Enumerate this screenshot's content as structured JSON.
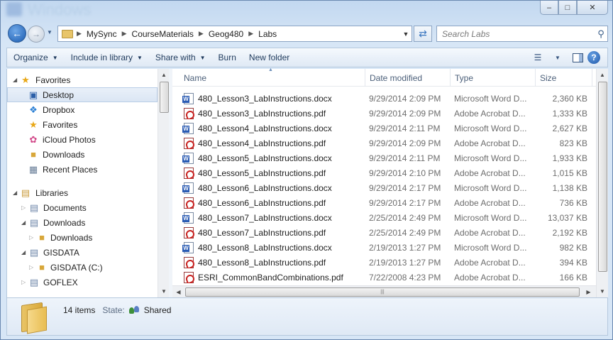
{
  "window": {
    "title": "Windows",
    "minimize_glyph": "–",
    "maximize_glyph": "□",
    "close_glyph": "✕"
  },
  "address": {
    "breadcrumb": [
      "MySync",
      "CourseMaterials",
      "Geog480",
      "Labs"
    ],
    "search_placeholder": "Search Labs"
  },
  "toolbar": {
    "organize": "Organize",
    "include_in_library": "Include in library",
    "share_with": "Share with",
    "burn": "Burn",
    "new_folder": "New folder"
  },
  "nav": {
    "favorites_header": "Favorites",
    "favorites": [
      "Desktop",
      "Dropbox",
      "Favorites",
      "iCloud Photos",
      "Downloads",
      "Recent Places"
    ],
    "libraries_header": "Libraries",
    "libraries": [
      "Documents",
      "Downloads",
      "Downloads"
    ],
    "gisdata": "GISDATA",
    "gisdata_c": "GISDATA (C:)",
    "goflex": "GOFLEX"
  },
  "columns": {
    "name": "Name",
    "date": "Date modified",
    "type": "Type",
    "size": "Size"
  },
  "files": [
    {
      "name": "480_Lesson3_LabInstructions.docx",
      "date": "9/29/2014 2:09 PM",
      "type": "Microsoft Word D...",
      "size": "2,360 KB",
      "kind": "docx"
    },
    {
      "name": "480_Lesson3_LabInstructions.pdf",
      "date": "9/29/2014 2:09 PM",
      "type": "Adobe Acrobat D...",
      "size": "1,333 KB",
      "kind": "pdf"
    },
    {
      "name": "480_Lesson4_LabInstructions.docx",
      "date": "9/29/2014 2:11 PM",
      "type": "Microsoft Word D...",
      "size": "2,627 KB",
      "kind": "docx"
    },
    {
      "name": "480_Lesson4_LabInstructions.pdf",
      "date": "9/29/2014 2:09 PM",
      "type": "Adobe Acrobat D...",
      "size": "823 KB",
      "kind": "pdf"
    },
    {
      "name": "480_Lesson5_LabInstructions.docx",
      "date": "9/29/2014 2:11 PM",
      "type": "Microsoft Word D...",
      "size": "1,933 KB",
      "kind": "docx"
    },
    {
      "name": "480_Lesson5_LabInstructions.pdf",
      "date": "9/29/2014 2:10 PM",
      "type": "Adobe Acrobat D...",
      "size": "1,015 KB",
      "kind": "pdf"
    },
    {
      "name": "480_Lesson6_LabInstructions.docx",
      "date": "9/29/2014 2:17 PM",
      "type": "Microsoft Word D...",
      "size": "1,138 KB",
      "kind": "docx"
    },
    {
      "name": "480_Lesson6_LabInstructions.pdf",
      "date": "9/29/2014 2:17 PM",
      "type": "Adobe Acrobat D...",
      "size": "736 KB",
      "kind": "pdf"
    },
    {
      "name": "480_Lesson7_LabInstructions.docx",
      "date": "2/25/2014 2:49 PM",
      "type": "Microsoft Word D...",
      "size": "13,037 KB",
      "kind": "docx"
    },
    {
      "name": "480_Lesson7_LabInstructions.pdf",
      "date": "2/25/2014 2:49 PM",
      "type": "Adobe Acrobat D...",
      "size": "2,192 KB",
      "kind": "pdf"
    },
    {
      "name": "480_Lesson8_LabInstructions.docx",
      "date": "2/19/2013 1:27 PM",
      "type": "Microsoft Word D...",
      "size": "982 KB",
      "kind": "docx"
    },
    {
      "name": "480_Lesson8_LabInstructions.pdf",
      "date": "2/19/2013 1:27 PM",
      "type": "Adobe Acrobat D...",
      "size": "394 KB",
      "kind": "pdf"
    },
    {
      "name": "ESRI_CommonBandCombinations.pdf",
      "date": "7/22/2008 4:23 PM",
      "type": "Adobe Acrobat D...",
      "size": "166 KB",
      "kind": "pdf"
    }
  ],
  "details": {
    "count": "14 items",
    "state_label": "State:",
    "state_value": "Shared"
  },
  "icons": {
    "star": "star-icon",
    "desktop": "desktop-icon",
    "dropbox": "dropbox-icon",
    "folder": "folder-icon",
    "library": "library-icon",
    "drive": "drive-icon"
  }
}
